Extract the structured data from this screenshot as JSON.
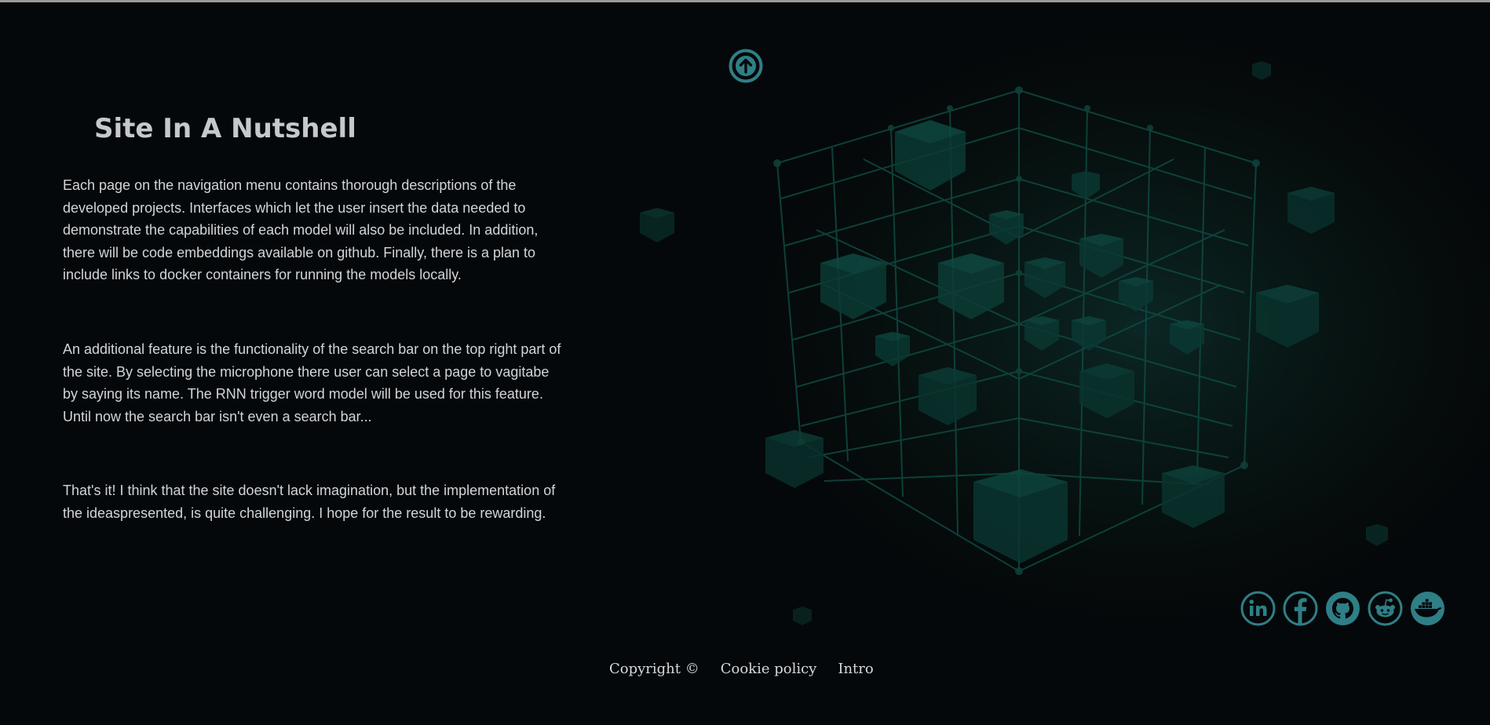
{
  "page": {
    "accent_color": "#2f7f86",
    "background_color": "#05080a"
  },
  "scroll_top": {
    "icon": "arrow-up-circle-icon"
  },
  "content": {
    "title": "Site In A Nutshell",
    "paragraphs": [
      "Each page on the navigation menu contains thorough descriptions of the developed projects. Interfaces which let the user insert the data needed to demonstrate the capabilities of each model will also be included. In addition, there will be code embeddings available on github. Finally, there is a plan to include links to docker containers for running the models locally.",
      "An additional feature is the functionality of the search bar on the top right part of the site. By selecting the microphone there user can select a page to vagitabe by saying its name. The RNN trigger word model will be used for this feature. Until now the search bar isn't even a search bar...",
      "That's it! I think that the site doesn't lack imagination, but the implementation of the ideaspresented, is quite challenging. I hope for the result to be rewarding."
    ]
  },
  "socials": [
    {
      "name": "linkedin",
      "icon": "linkedin-icon",
      "label": "in"
    },
    {
      "name": "facebook",
      "icon": "facebook-icon",
      "label": "f"
    },
    {
      "name": "github",
      "icon": "github-icon"
    },
    {
      "name": "reddit",
      "icon": "reddit-icon"
    },
    {
      "name": "docker",
      "icon": "docker-icon"
    }
  ],
  "footer": {
    "copyright": "Copyright ©",
    "cookie_policy": "Cookie policy",
    "intro": "Intro"
  }
}
